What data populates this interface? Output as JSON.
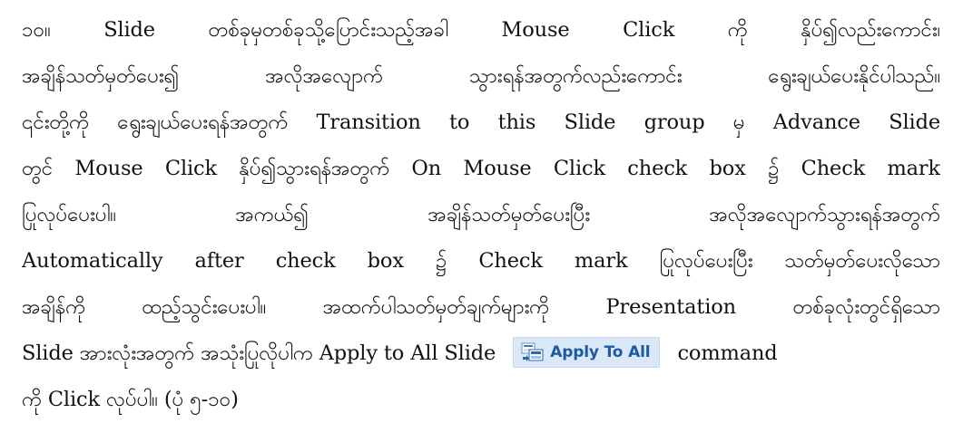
{
  "paragraph": {
    "lines": [
      "၁၀။   Slide တစ်ခုမှတစ်ခုသို့ပြောင်းသည့်အခါ Mouse Click ကို နှိပ်၍လည်းကောင်း၊",
      "အချိန်သတ်မှတ်ပေး၍ အလိုအလျောက် သွားရန်အတွက်လည်းကောင်း ရွေးချယ်ပေးနိုင်ပါသည်။",
      "၎င်းတို့ကို ရွေးချယ်ပေးရန်အတွက် Transition to this Slide group မှ Advance Slide",
      "တွင် Mouse Click နှိပ်၍သွားရန်အတွက် On Mouse Click check box ၌ Check mark",
      "ပြုလုပ်ပေးပါ။ အကယ်၍ အချိန်သတ်မှတ်ပေးပြီး အလိုအလျောက်သွားရန်အတွက်",
      "Automatically after check box ၌ Check mark ပြုလုပ်ပေးပြီး သတ်မှတ်ပေးလိုသော",
      "အချိန်ကို ထည့်သွင်းပေးပါ။ အထက်ပါသတ်မှတ်ချက်များကို Presentation တစ်ခုလုံးတွင်ရှိသော"
    ],
    "line8_before": "Slide အားလုံးအတွက် အသုံးပြုလိုပါက Apply to All Slide",
    "line8_after": "command",
    "line9": "ကို Click လုပ်ပါ။ (ပုံ ၅-၁၀)"
  },
  "apply_button": {
    "label": "Apply To All",
    "icon": "apply-to-all-icon",
    "text_color": "#1c5aa6",
    "background": "#dbe8f7"
  }
}
